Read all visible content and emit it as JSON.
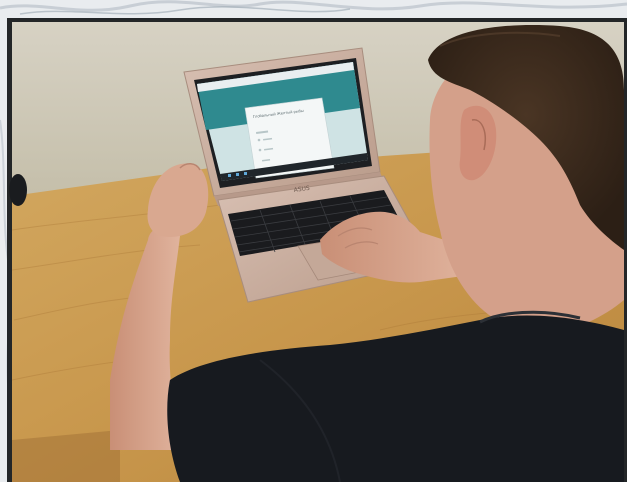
{
  "photo": {
    "laptop_brand": "ASUS",
    "screen_form_title": "Глобальный Желтый рыбы"
  },
  "colors": {
    "frame": "#232628",
    "wall": "#cfc9b8",
    "desk": "#c99a4f",
    "laptop": "#c8ad9e",
    "screen_teal": "#2f8a8f",
    "shirt": "#171a1f",
    "skin": "#d9a890",
    "hair": "#3b2a1d"
  }
}
